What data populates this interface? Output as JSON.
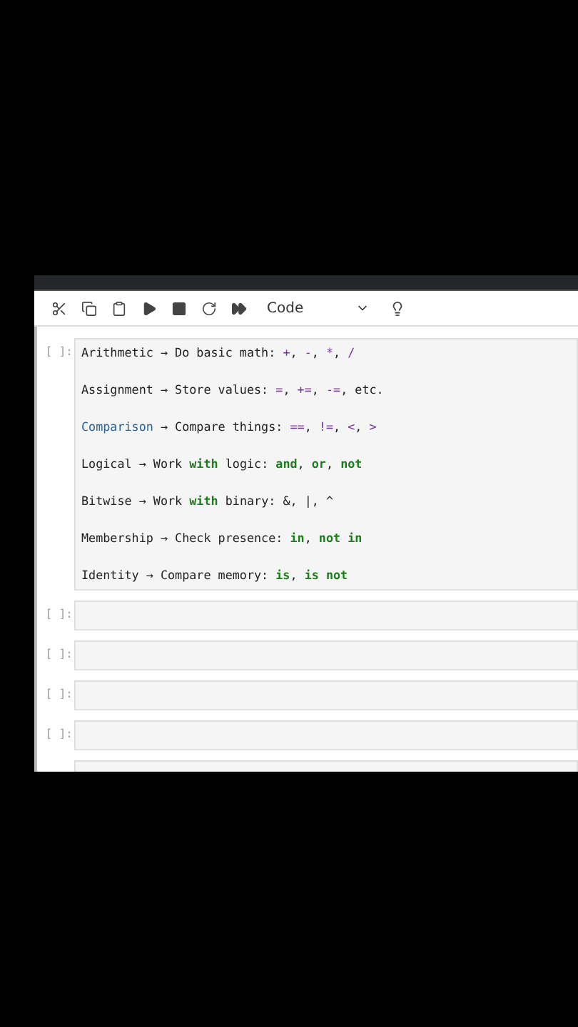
{
  "toolbar": {
    "cell_type": "Code"
  },
  "cells": [
    {
      "prompt": "[ ]:",
      "lines": [
        [
          {
            "kind": "plain",
            "text": "Arithmetic → Do basic math: "
          },
          {
            "kind": "operator",
            "text": "+"
          },
          {
            "kind": "plain",
            "text": ", "
          },
          {
            "kind": "operator",
            "text": "-"
          },
          {
            "kind": "plain",
            "text": ", "
          },
          {
            "kind": "operator",
            "text": "*"
          },
          {
            "kind": "plain",
            "text": ", "
          },
          {
            "kind": "operator",
            "text": "/"
          }
        ],
        [
          {
            "kind": "plain",
            "text": "Assignment → Store values: "
          },
          {
            "kind": "operator",
            "text": "="
          },
          {
            "kind": "plain",
            "text": ", "
          },
          {
            "kind": "operator",
            "text": "+="
          },
          {
            "kind": "plain",
            "text": ", "
          },
          {
            "kind": "operator",
            "text": "-="
          },
          {
            "kind": "plain",
            "text": ", etc."
          }
        ],
        [
          {
            "kind": "name",
            "text": "Comparison"
          },
          {
            "kind": "plain",
            "text": " → Compare things: "
          },
          {
            "kind": "operator",
            "text": "=="
          },
          {
            "kind": "plain",
            "text": ", "
          },
          {
            "kind": "operator",
            "text": "!="
          },
          {
            "kind": "plain",
            "text": ", "
          },
          {
            "kind": "operator",
            "text": "<"
          },
          {
            "kind": "plain",
            "text": ", "
          },
          {
            "kind": "operator",
            "text": ">"
          }
        ],
        [
          {
            "kind": "plain",
            "text": "Logical → Work "
          },
          {
            "kind": "keyword",
            "text": "with"
          },
          {
            "kind": "plain",
            "text": " logic: "
          },
          {
            "kind": "keyword",
            "text": "and"
          },
          {
            "kind": "plain",
            "text": ", "
          },
          {
            "kind": "keyword",
            "text": "or"
          },
          {
            "kind": "plain",
            "text": ", "
          },
          {
            "kind": "keyword",
            "text": "not"
          }
        ],
        [
          {
            "kind": "plain",
            "text": "Bitwise → Work "
          },
          {
            "kind": "keyword",
            "text": "with"
          },
          {
            "kind": "plain",
            "text": " binary: &, |, ^"
          }
        ],
        [
          {
            "kind": "plain",
            "text": "Membership → Check presence: "
          },
          {
            "kind": "keyword",
            "text": "in"
          },
          {
            "kind": "plain",
            "text": ", "
          },
          {
            "kind": "keyword",
            "text": "not in"
          }
        ],
        [
          {
            "kind": "plain",
            "text": "Identity → Compare memory: "
          },
          {
            "kind": "keyword",
            "text": "is"
          },
          {
            "kind": "plain",
            "text": ", "
          },
          {
            "kind": "keyword",
            "text": "is not"
          }
        ]
      ]
    },
    {
      "prompt": "[ ]:"
    },
    {
      "prompt": "[ ]:"
    },
    {
      "prompt": "[ ]:"
    },
    {
      "prompt": "[ ]:"
    }
  ]
}
